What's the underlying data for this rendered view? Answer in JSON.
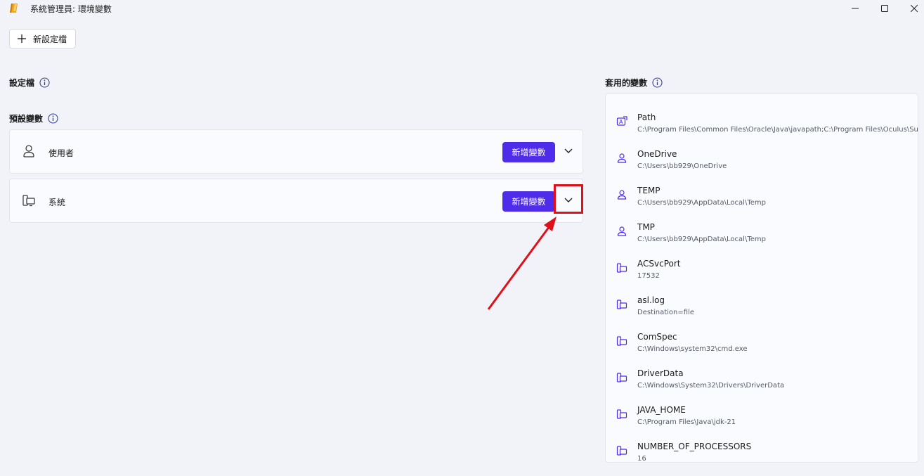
{
  "window": {
    "title": "系統管理員: 環境變數",
    "app_icon": "pencil-icon",
    "controls": [
      "minimize-icon",
      "maximize-icon",
      "close-icon"
    ]
  },
  "toolbar": {
    "new_profile_label": "新設定檔"
  },
  "profiles_section": {
    "label": "設定檔"
  },
  "default_vars_section": {
    "label": "預設變數",
    "cards": [
      {
        "label": "使用者",
        "icon": "user-icon",
        "add_label": "新增變數"
      },
      {
        "label": "系統",
        "icon": "system-icon",
        "add_label": "新增變數"
      }
    ]
  },
  "applied_section": {
    "label": "套用的變數",
    "items": [
      {
        "name": "Path",
        "value": "C:\\Program Files\\Common Files\\Oracle\\Java\\javapath;C:\\Program Files\\Oculus\\Support",
        "icon": "path-icon"
      },
      {
        "name": "OneDrive",
        "value": "C:\\Users\\bb929\\OneDrive",
        "icon": "user-icon"
      },
      {
        "name": "TEMP",
        "value": "C:\\Users\\bb929\\AppData\\Local\\Temp",
        "icon": "user-icon"
      },
      {
        "name": "TMP",
        "value": "C:\\Users\\bb929\\AppData\\Local\\Temp",
        "icon": "user-icon"
      },
      {
        "name": "ACSvcPort",
        "value": "17532",
        "icon": "system-icon"
      },
      {
        "name": "asl.log",
        "value": "Destination=file",
        "icon": "system-icon"
      },
      {
        "name": "ComSpec",
        "value": "C:\\Windows\\system32\\cmd.exe",
        "icon": "system-icon"
      },
      {
        "name": "DriverData",
        "value": "C:\\Windows\\System32\\Drivers\\DriverData",
        "icon": "system-icon"
      },
      {
        "name": "JAVA_HOME",
        "value": "C:\\Program Files\\Java\\jdk-21",
        "icon": "system-icon"
      },
      {
        "name": "NUMBER_OF_PROCESSORS",
        "value": "16",
        "icon": "system-icon"
      }
    ]
  },
  "colors": {
    "accent": "#4f2bea",
    "annotation": "#e0101b",
    "background": "#f1f3f9"
  }
}
